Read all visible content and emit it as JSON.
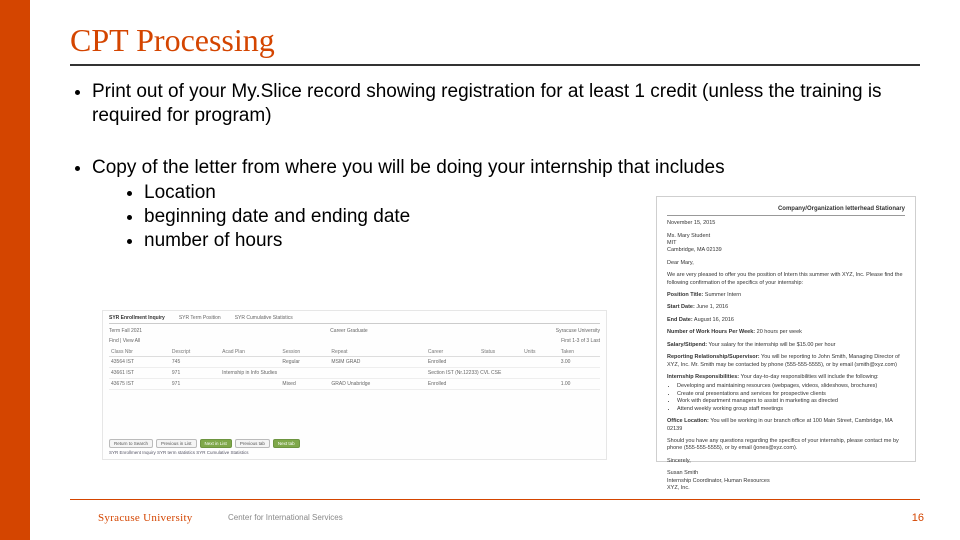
{
  "slide": {
    "title": "CPT Processing",
    "bullets": {
      "b1": "Print out of your My.Slice record showing registration for at least 1 credit (unless the training is required for program)",
      "b2": "Copy of the letter from where you will be doing your internship that includes",
      "sub1": "Location",
      "sub2": "beginning date and ending date",
      "sub3": "number of hours"
    }
  },
  "record": {
    "tabs": {
      "t1": "SYR Enrollment Inquiry",
      "t2": "SYR Term Position",
      "t3": "SYR Cumulative Statistics"
    },
    "termline": {
      "term": "Term  Fall 2021",
      "career": "Career  Graduate",
      "inst": "Syracuse University"
    },
    "pager": {
      "label": "Find | View All",
      "range": "First  1-3 of 3  Last"
    },
    "headers": {
      "h1": "Class Nbr",
      "h2": "Descript",
      "h3": "Acad Plan",
      "h4": "Session",
      "h5": "Repeat",
      "h6": "Career",
      "h7": "Status",
      "h8": "Units",
      "h9": "Taken"
    },
    "rows": [
      {
        "c1": "43564 IST",
        "c2": "745",
        "c3": "",
        "c4": "Regular",
        "c5": "MSIM  GRAD",
        "c6": "Enrolled",
        "c7": "",
        "c8": "",
        "c9": "3.00"
      },
      {
        "c1": "43661 IST",
        "c2": "971",
        "c3": "Internship in Info Studies",
        "c4": "",
        "c5": "Section  IST  (Nr.12233)  CVL  CSE",
        "c6": "",
        "c7": "",
        "c8": "",
        "c9": ""
      },
      {
        "c1": "43675 IST",
        "c2": "971",
        "c3": "",
        "c4": "Mixed",
        "c5": "GRAD  Unabridge",
        "c6": "Enrolled",
        "c7": "",
        "c8": "",
        "c9": "1.00"
      }
    ],
    "buttons": {
      "b1": "Return to Search",
      "b2": "Previous in List",
      "b3": "Next in List",
      "b4": "Previous tab",
      "b5": "Next tab"
    },
    "footerlinks": "SYR Enrollment Inquiry   SYR term statistics   SYR Cumulative Statistics"
  },
  "letter": {
    "header": "Company/Organization letterhead Stationary",
    "date": "November 15, 2015",
    "to1": "Ms. Mary Student",
    "to2": "MIT",
    "to3": "Cambridge, MA 02139",
    "greeting": "Dear Mary,",
    "intro": "We are very pleased to offer you the position of Intern this summer with XYZ, Inc. Please find the following confirmation of the specifics of your internship:",
    "pos_label": "Position Title:",
    "pos_val": "Summer Intern",
    "start_label": "Start Date:",
    "start_val": "June 1, 2016",
    "end_label": "End Date:",
    "end_val": "August 16, 2016",
    "hours_label": "Number of Work Hours Per Week:",
    "hours_val": "20 hours per week",
    "salary_label": "Salary/Stipend:",
    "salary_val": "Your salary for the internship will be $15.00 per hour",
    "report_label": "Reporting Relationship/Supervisor:",
    "report_val": "You will be reporting to John Smith, Managing Director of XYZ, Inc. Mr. Smith may be contacted by phone (555-555-5555), or by email (smith@xyz.com)",
    "resp_label": "Internship Responsibilities:",
    "resp_intro": "Your day-to-day responsibilities will include the following:",
    "resp1": "Developing and maintaining resources (webpages, videos, slideshows, brochures)",
    "resp2": "Create oral presentations and services for prospective clients",
    "resp3": "Work with department managers to assist in marketing as directed",
    "resp4": "Attend weekly working group staff meetings",
    "loc_label": "Office Location:",
    "loc_val": "You will be working in our branch office at 100 Main Street, Cambridge, MA 02139",
    "closing": "Should you have any questions regarding the specifics of your internship, please contact me by phone (555-555-5555), or by email (jones@xyz.com).",
    "signoff": "Sincerely,",
    "signer1": "Susan Smith",
    "signer2": "Internship Coordinator, Human Resources",
    "signer3": "XYZ, Inc."
  },
  "footer": {
    "logo": "Syracuse University",
    "center": "Center for International Services",
    "page": "16"
  }
}
